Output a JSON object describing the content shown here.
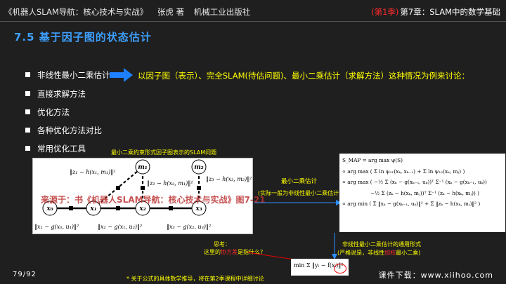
{
  "header": {
    "book_title": "《机器人SLAM导航：核心技术与实战》",
    "author": "张虎 著",
    "publisher": "机械工业出版社",
    "season": "(第1季)",
    "chapter": "第7章：SLAM中的数学基础"
  },
  "section_title": "7.5 基于因子图的状态估计",
  "bullets": [
    {
      "label": "非线性最小二乘估计"
    },
    {
      "label": "直接求解方法"
    },
    {
      "label": "优化方法"
    },
    {
      "label": "各种优化方法对比"
    },
    {
      "label": "常用优化工具"
    }
  ],
  "intro_text": "以因子图（表示）、完全SLAM(待估问题)、最小二乘估计（求解方法）这种情况为例来讨论：",
  "graph": {
    "caption": "最小二乘约束形式因子图表示的SLAM问题",
    "watermark": "来源于：书《机器人SLAM导航：核心技术与实战》图7-21",
    "nodes": {
      "x0": "x₀",
      "x1": "x₁",
      "x2": "x₂",
      "x3": "x₃",
      "m1": "m₁",
      "m2": "m₂"
    },
    "obs_labels": {
      "z1": "‖z₁ − h(x₁, m₁)‖²",
      "z2": "‖z₂ − h(x₂, m₁)‖²",
      "z3": "‖z₃ − h(x₃, m₂)‖²"
    },
    "odom_labels": {
      "o1": "‖x₁ − g(x₀, u₁)‖²",
      "o2": "‖x₂ − g(x₁, u₂)‖²",
      "o3": "‖x₃ − g(x₂, u₃)‖²"
    }
  },
  "annotations": {
    "nls_label": "最小二乘估计",
    "nls_note": "(实际一般为非线性最小二乘估计)",
    "general_form": "非线性最小二乘估计的通用形式",
    "strict_prefix": "(严格说是，非线性",
    "strict_red": "加权",
    "strict_suffix": "最小二乘)",
    "think_title": "思考：",
    "think_prefix": "这里的",
    "think_red": "协方差",
    "think_suffix": "是指什么?",
    "footnote": "* 关于公式的具体数学推导，将在第2季课程中详细讨论"
  },
  "formulas": {
    "l1": "S_MAP = arg max ψ(S)",
    "l2": "∝ arg max ( Σ ln ψ₀₁(xₖ, xₖ₋₁) + Σ ln ψ₁₂(xₖ, mⱼ) )",
    "l3": "∝ arg max ( −½ Σ (xₖ − g(xₖ₋₁, uₖ))ᵀ Σ⁻¹ (xₖ − g(xₖ₋₁, uₖ))",
    "l4": "−½ Σ (zₖ − h(xₖ, mⱼ))ᵀ Σ⁻¹ (zₖ − h(xₖ, mⱼ)) )",
    "l5": "∝ arg min ( Σ ‖xₖ − g(xₖ₋₁, uₖ)‖² + Σ ‖zₖ − h(xₖ, mⱼ)‖² )",
    "min_form": "min Σ ‖yᵢ − f(xᵢ)‖²"
  },
  "footer": {
    "page": "79/92",
    "download": "课件下载：www.xiihoo.com"
  }
}
